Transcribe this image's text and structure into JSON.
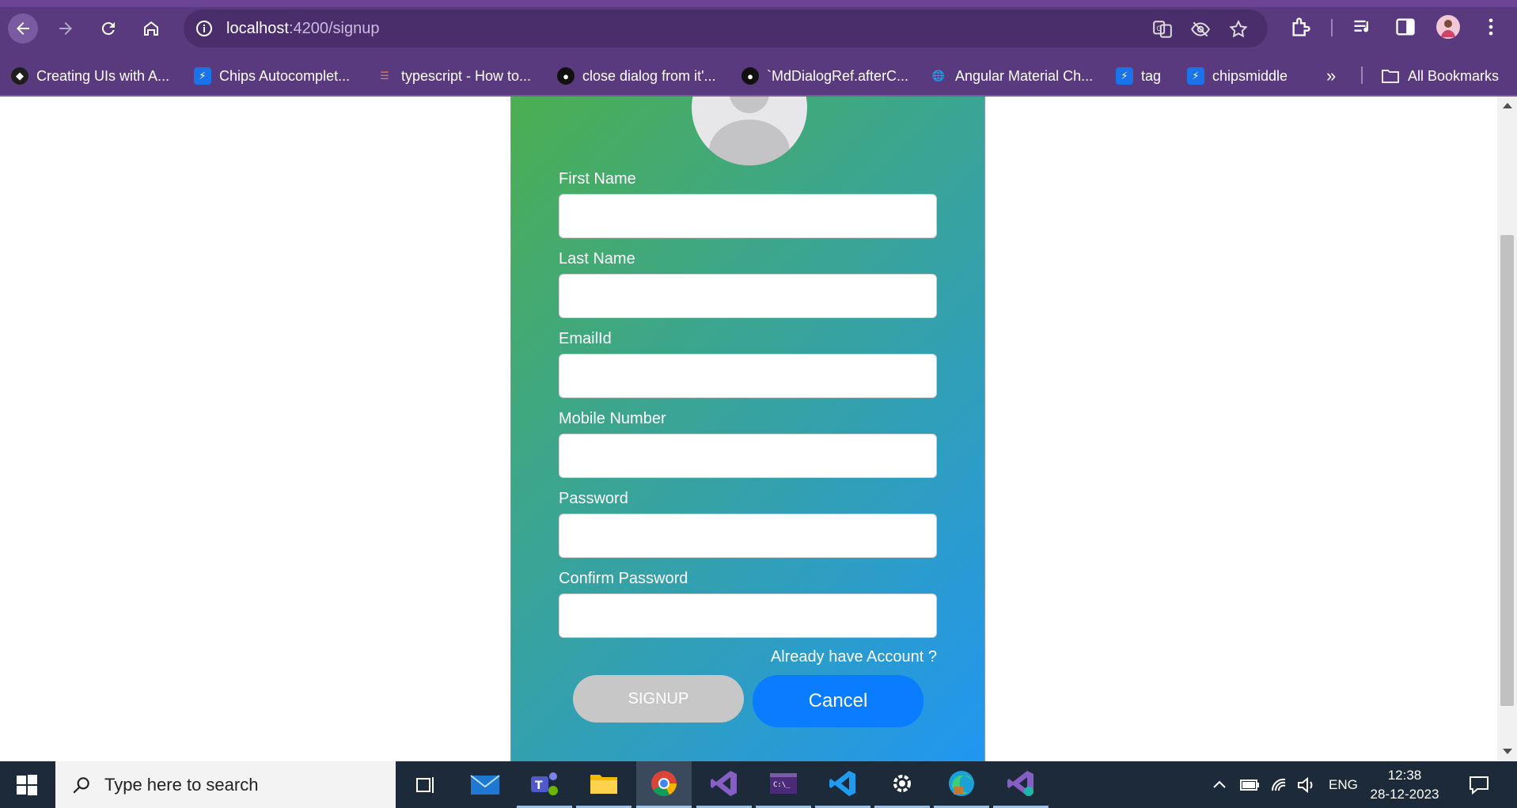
{
  "browser": {
    "url_host": "localhost",
    "url_rest": ":4200/signup",
    "bookmarks": [
      {
        "label": "Creating UIs with A...",
        "icon": "site-dark-icon"
      },
      {
        "label": "Chips Autocomplet...",
        "icon": "stackblitz-icon"
      },
      {
        "label": "typescript - How to...",
        "icon": "stackoverflow-icon"
      },
      {
        "label": "close dialog from it'...",
        "icon": "github-icon"
      },
      {
        "label": "`MdDialogRef.afterC...",
        "icon": "github-icon"
      },
      {
        "label": "Angular Material Ch...",
        "icon": "globe-icon"
      },
      {
        "label": "tag",
        "icon": "stackblitz-icon"
      },
      {
        "label": "chipsmiddle",
        "icon": "stackblitz-icon"
      }
    ],
    "more_bookmarks": "»",
    "all_bookmarks": "All Bookmarks"
  },
  "form": {
    "fields": [
      {
        "label": "First Name",
        "value": "",
        "placeholder": ""
      },
      {
        "label": "Last Name",
        "value": "",
        "placeholder": ""
      },
      {
        "label": "EmailId",
        "value": "",
        "placeholder": ""
      },
      {
        "label": "Mobile Number",
        "value": "",
        "placeholder": ""
      },
      {
        "label": "Password",
        "value": "",
        "placeholder": ""
      },
      {
        "label": "Confirm Password",
        "value": "",
        "placeholder": ""
      }
    ],
    "already_link": "Already have Account ?",
    "signup_label": "SIGNUP",
    "cancel_label": "Cancel",
    "gradient_start": "#4caf50",
    "gradient_end": "#2196f3",
    "cancel_color": "#0a7cff",
    "signup_disabled_color": "#c7c7c7"
  },
  "taskbar": {
    "search_placeholder": "Type here to search",
    "language": "ENG",
    "time": "12:38",
    "date": "28-12-2023",
    "apps": [
      "task-view-icon",
      "mail-icon",
      "teams-icon",
      "file-explorer-icon",
      "chrome-icon",
      "visual-studio-icon",
      "terminal-icon",
      "vscode-icon",
      "settings-icon",
      "edge-icon",
      "visual-studio-installer-icon"
    ]
  }
}
